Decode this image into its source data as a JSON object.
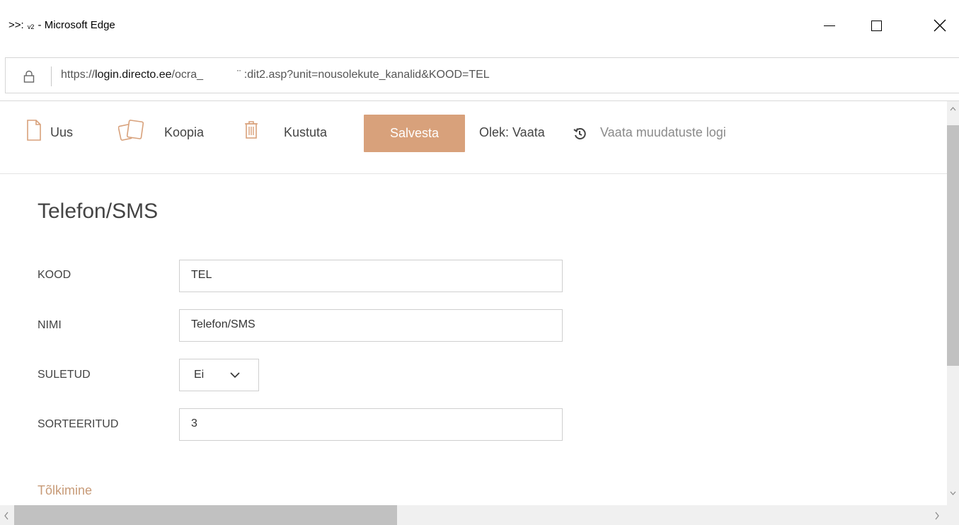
{
  "window": {
    "title_prefix": ">>:",
    "title_sub": "v2",
    "title_suffix": "- Microsoft Edge"
  },
  "address": {
    "url_scheme": "https://",
    "url_host": "login.directo.ee",
    "url_path": "/ocra_",
    "url_rest": "¨ :dit2.asp?unit=nousolekute_kanalid&KOOD=TEL"
  },
  "toolbar": {
    "new_label": "Uus",
    "copy_label": "Koopia",
    "delete_label": "Kustuta",
    "save_label": "Salvesta",
    "status_label": "Olek: Vaata",
    "log_label": "Vaata muudatuste logi"
  },
  "form": {
    "title": "Telefon/SMS",
    "fields": [
      {
        "label": "KOOD",
        "value": "TEL"
      },
      {
        "label": "NIMI",
        "value": "Telefon/SMS"
      },
      {
        "label": "SULETUD",
        "value": "Ei"
      },
      {
        "label": "SORTEERITUD",
        "value": "3"
      }
    ],
    "section_label": "Tõlkimine"
  },
  "colors": {
    "accent": "#d8a17b",
    "section": "#c79a77"
  },
  "icons": [
    "lock-icon",
    "new-document-icon",
    "copy-icon",
    "trash-icon",
    "history-icon",
    "chevron-down-icon",
    "minimize-icon",
    "maximize-icon",
    "close-icon"
  ]
}
